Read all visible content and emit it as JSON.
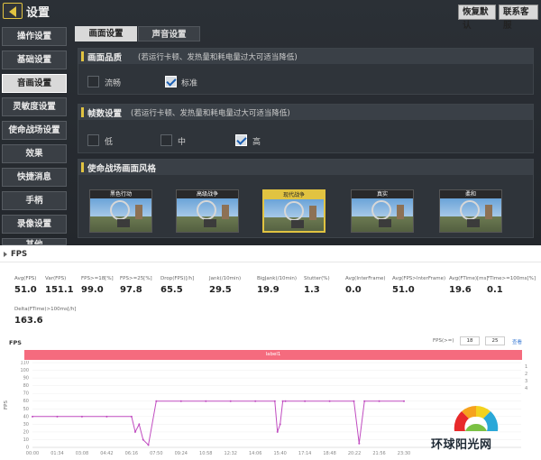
{
  "game": {
    "title": "设置",
    "restore_label": "恢复默认",
    "contact_label": "联系客服",
    "menu": [
      "操作设置",
      "基础设置",
      "音画设置",
      "灵敏度设置",
      "使命战场设置",
      "效果",
      "快捷消息",
      "手柄",
      "录像设置",
      "其他"
    ],
    "active_menu_index": 2,
    "tabs": [
      "画面设置",
      "声音设置"
    ],
    "active_tab_index": 0,
    "quality": {
      "title": "画面品质",
      "note": "(若运行卡顿、发热量和耗电量过大可适当降低)",
      "options": [
        {
          "label": "流畅",
          "checked": false
        },
        {
          "label": "标准",
          "checked": true
        }
      ]
    },
    "framerate": {
      "title": "帧数设置",
      "note": "(若运行卡顿、发热量和耗电量过大可适当降低)",
      "options": [
        {
          "label": "低",
          "checked": false
        },
        {
          "label": "中",
          "checked": false
        },
        {
          "label": "高",
          "checked": true
        }
      ]
    },
    "style": {
      "title": "使命战场画面风格",
      "cards": [
        "黑色行动",
        "高级战争",
        "现代战争",
        "真实",
        "柔和"
      ],
      "active_index": 2
    }
  },
  "perf": {
    "title": "FPS",
    "metrics": [
      {
        "label": "Avg(FPS)",
        "value": "51.0"
      },
      {
        "label": "Var(FPS)",
        "value": "151.1"
      },
      {
        "label": "FPS>=18[%]",
        "value": "99.0"
      },
      {
        "label": "FPS>=25[%]",
        "value": "97.8"
      },
      {
        "label": "Drop(FPS)[/h]",
        "value": "65.5"
      },
      {
        "label": "Jank(/10min)",
        "value": "29.5"
      },
      {
        "label": "BigJank(/10min)",
        "value": "19.9"
      },
      {
        "label": "Stutter(%)",
        "value": "1.3"
      },
      {
        "label": "Avg(InterFrame)",
        "value": "0.0"
      },
      {
        "label": "Avg(FPS>InterFrame)",
        "value": "51.0"
      },
      {
        "label": "Avg(FTime)[ms]",
        "value": "19.6"
      },
      {
        "label": "FTime>=100ms[%]",
        "value": "0.1"
      },
      {
        "label": "Delta(FTime)>100ms[/h]",
        "value": "163.6"
      }
    ],
    "chart_title": "FPS",
    "filter_label": "FPS(>=)",
    "filter_values": [
      "18",
      "25"
    ],
    "filter_button": "查看",
    "label_bar": "label1"
  },
  "chart_data": {
    "type": "line",
    "title": "FPS",
    "ylabel": "FPS",
    "ylim": [
      0,
      110
    ],
    "yticks": [
      0,
      10,
      20,
      30,
      40,
      50,
      60,
      70,
      80,
      90,
      100,
      110
    ],
    "right_yticks": [
      "1",
      "2",
      "3",
      "4"
    ],
    "x_ticks": [
      "00:00",
      "01:34",
      "03:08",
      "04:42",
      "06:16",
      "07:50",
      "09:24",
      "10:58",
      "12:32",
      "14:06",
      "15:40",
      "17:14",
      "18:48",
      "20:22",
      "21:56",
      "23:30"
    ],
    "series": [
      {
        "color": "#c04bc0",
        "x": [
          "00:00",
          "01:34",
          "03:08",
          "04:42",
          "06:16",
          "06:30",
          "06:45",
          "07:00",
          "07:20",
          "07:50",
          "09:24",
          "10:58",
          "12:32",
          "14:06",
          "15:20",
          "15:30",
          "15:40",
          "15:50",
          "16:00",
          "17:14",
          "18:48",
          "20:20",
          "20:40",
          "21:00",
          "21:56",
          "23:30"
        ],
        "y": [
          40,
          40,
          40,
          40,
          40,
          20,
          30,
          10,
          3,
          60,
          60,
          60,
          60,
          60,
          60,
          20,
          30,
          60,
          60,
          60,
          60,
          60,
          5,
          60,
          60,
          60
        ]
      }
    ]
  },
  "watermark": {
    "text": "环球阳光网"
  },
  "colors": {
    "accent": "#e1c341",
    "series": "#c04bc0",
    "label_bar": "#f56b7e"
  }
}
